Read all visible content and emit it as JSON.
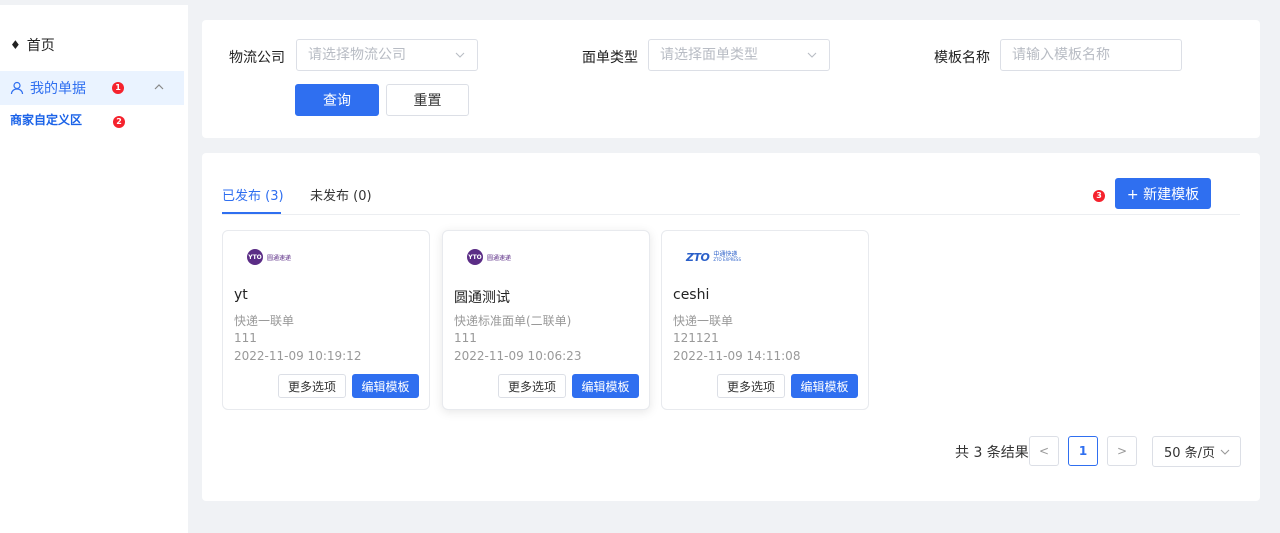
{
  "sidebar": {
    "home_label": "首页",
    "mine_label": "我的单据",
    "mine_badge": "1",
    "merchant_label": "商家自定义区",
    "merchant_badge": "2"
  },
  "filter": {
    "company_label": "物流公司",
    "company_placeholder": "请选择物流公司",
    "type_label": "面单类型",
    "type_placeholder": "请选择面单类型",
    "name_label": "模板名称",
    "name_placeholder": "请输入模板名称",
    "query_label": "查询",
    "reset_label": "重置"
  },
  "tabs": {
    "published": "已发布 (3)",
    "unpublished": "未发布 (0)",
    "new_badge": "3",
    "new_label": "+ 新建模板"
  },
  "cards": [
    {
      "logo": "圆通速递",
      "logo_mark": "YTO",
      "title": "yt",
      "type": "快递一联单",
      "code": "111",
      "time": "2022-11-09 10:19:12",
      "more": "更多选项",
      "edit": "编辑模板"
    },
    {
      "logo": "圆通速递",
      "logo_mark": "YTO",
      "title": "圆通测试",
      "type": "快递标准面单(二联单)",
      "code": "111",
      "time": "2022-11-09 10:06:23",
      "more": "更多选项",
      "edit": "编辑模板"
    },
    {
      "logo": "中通快递",
      "logo_mark": "ZTO",
      "logo_sub": "ZTO EXPRESS",
      "title": "ceshi",
      "type": "快递一联单",
      "code": "121121",
      "time": "2022-11-09 14:11:08",
      "more": "更多选项",
      "edit": "编辑模板"
    }
  ],
  "pagination": {
    "total": "共 3 条结果",
    "prev": "<",
    "current": "1",
    "next": ">",
    "page_size": "50 条/页"
  },
  "colors": {
    "primary": "#2f6ff0",
    "badge": "#f5222d",
    "background": "#f0f2f5"
  }
}
